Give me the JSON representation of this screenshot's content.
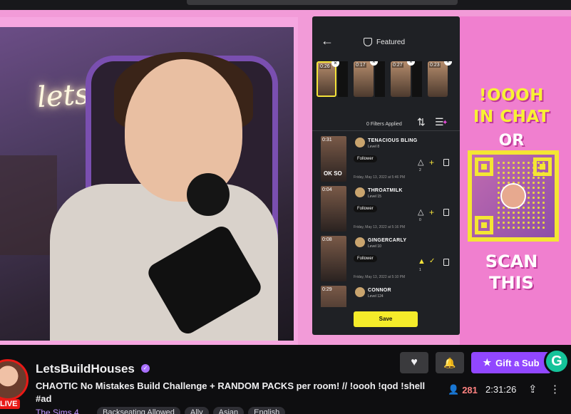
{
  "stream": {
    "neon_sign": "letsBuild"
  },
  "panel": {
    "featured_label": "Featured",
    "thumbnails": [
      {
        "duration": "0:26",
        "selected": true
      },
      {
        "duration": "0:17",
        "selected": false
      },
      {
        "duration": "0:27",
        "selected": false
      },
      {
        "duration": "0:23",
        "selected": false
      }
    ],
    "filters_label": "0 Filters Applied",
    "entries": [
      {
        "duration": "0:31",
        "overlay": "OK SO",
        "username": "TENACIOUS BLING",
        "level": "Level 8",
        "badge": "Follower",
        "date": "Friday, May 13, 2022 at 5:46 PM",
        "votes": "2",
        "action": "+"
      },
      {
        "duration": "0:04",
        "overlay": "",
        "username": "THROATMILK",
        "level": "Level 15",
        "badge": "Follower",
        "date": "Friday, May 13, 2022 at 5:16 PM",
        "votes": "0",
        "action": "+"
      },
      {
        "duration": "0:08",
        "overlay": "",
        "username": "GINGERCARLY",
        "level": "Level 10",
        "badge": "Follower",
        "date": "Friday, May 13, 2022 at 5:10 PM",
        "votes": "1",
        "action": "✓"
      },
      {
        "duration": "0:29",
        "overlay": "",
        "username": "CONNOR",
        "level": "Level 124",
        "badge": "",
        "date": "",
        "votes": "",
        "action": ""
      }
    ],
    "save_label": "Save"
  },
  "promo": {
    "line1": "!OOOH",
    "line2": "IN CHAT",
    "line3": "OR",
    "line4": "SCAN",
    "line5": "THIS"
  },
  "info": {
    "live_label": "LIVE",
    "channel_name": "LetsBuildHouses",
    "title": "CHAOTIC No Mistakes Build Challenge + RANDOM PACKS per room! // !oooh !qod !shell #ad",
    "game": "The Sims 4",
    "tags": [
      "Backseating Allowed",
      "Ally",
      "Asian",
      "English"
    ],
    "gift_label": "Gift a Sub",
    "viewers": "281",
    "uptime": "2:31:26"
  },
  "colors": {
    "accent": "#9147ff",
    "live": "#e91916",
    "promo_yellow": "#f8f234",
    "promo_pink": "#f07fcf"
  }
}
